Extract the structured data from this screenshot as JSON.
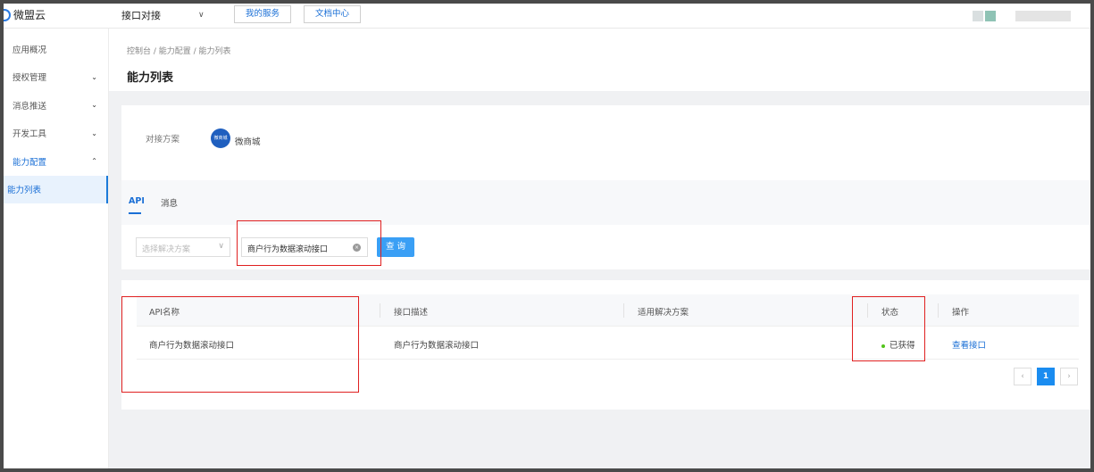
{
  "header": {
    "logo_text": "微盟云",
    "product_select": "接口对接",
    "my_service": "我的服务",
    "doc_center": "文档中心"
  },
  "sidebar": {
    "items": [
      {
        "label": "应用概况",
        "arrow": ""
      },
      {
        "label": "授权管理",
        "arrow": "⌄"
      },
      {
        "label": "消息推送",
        "arrow": "⌄"
      },
      {
        "label": "开发工具",
        "arrow": "⌄"
      },
      {
        "label": "能力配置",
        "arrow": "⌃"
      },
      {
        "label": "能力列表",
        "arrow": ""
      }
    ]
  },
  "page": {
    "breadcrumb": "控制台 / 能力配置 / 能力列表",
    "title": "能力列表"
  },
  "plan": {
    "label": "对接方案",
    "avatar_text": "微商城",
    "name": "微商城"
  },
  "tabs": [
    "API",
    "消息"
  ],
  "filter": {
    "solution_placeholder": "选择解决方案",
    "search_value": "商户行为数据滚动接口",
    "query_label": "查 询"
  },
  "table": {
    "columns": [
      "API名称",
      "接口描述",
      "适用解决方案",
      "状态",
      "操作"
    ],
    "rows": [
      {
        "name": "商户行为数据滚动接口",
        "desc": "商户行为数据滚动接口",
        "solution": "",
        "status": "已获得",
        "action": "查看接口"
      }
    ]
  },
  "pagination": {
    "prev": "‹",
    "current": "1",
    "next": "›"
  },
  "colors": {
    "accent": "#1a6fd6",
    "highlight": "#e02020",
    "status_ok": "#52c41a"
  }
}
